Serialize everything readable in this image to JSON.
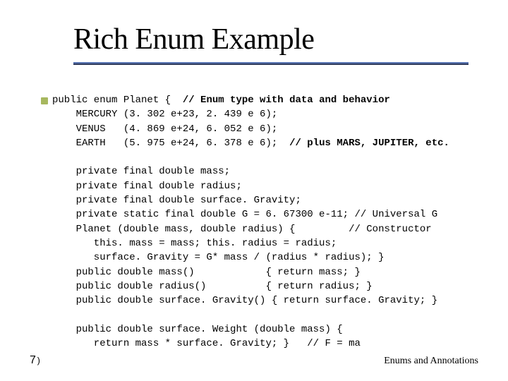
{
  "title": "Rich Enum Example",
  "code": {
    "l1a": "public enum Planet {  ",
    "l1b": "// Enum type with data and behavior",
    "l2": "    MERCURY (3. 302 e+23, 2. 439 e 6);",
    "l3": "    VENUS   (4. 869 e+24, 6. 052 e 6);",
    "l4a": "    EARTH   (5. 975 e+24, 6. 378 e 6);  ",
    "l4b": "// plus MARS, JUPITER, etc.",
    "blank1": " ",
    "l5": "    private final double mass;",
    "l6": "    private final double radius;",
    "l7": "    private final double surface. Gravity;",
    "l8": "    private static final double G = 6. 67300 e-11; // Universal G",
    "l9": "    Planet (double mass, double radius) {         // Constructor",
    "l10": "       this. mass = mass; this. radius = radius;",
    "l11": "       surface. Gravity = G* mass / (radius * radius); }",
    "l12": "    public double mass()            { return mass; }",
    "l13": "    public double radius()          { return radius; }",
    "l14": "    public double surface. Gravity() { return surface. Gravity; }",
    "blank2": " ",
    "l15": "    public double surface. Weight (double mass) {",
    "l16": "       return mass * surface. Gravity; }   // F = ma"
  },
  "page_number": "7",
  "paren": ")",
  "footer": "Enums and Annotations"
}
